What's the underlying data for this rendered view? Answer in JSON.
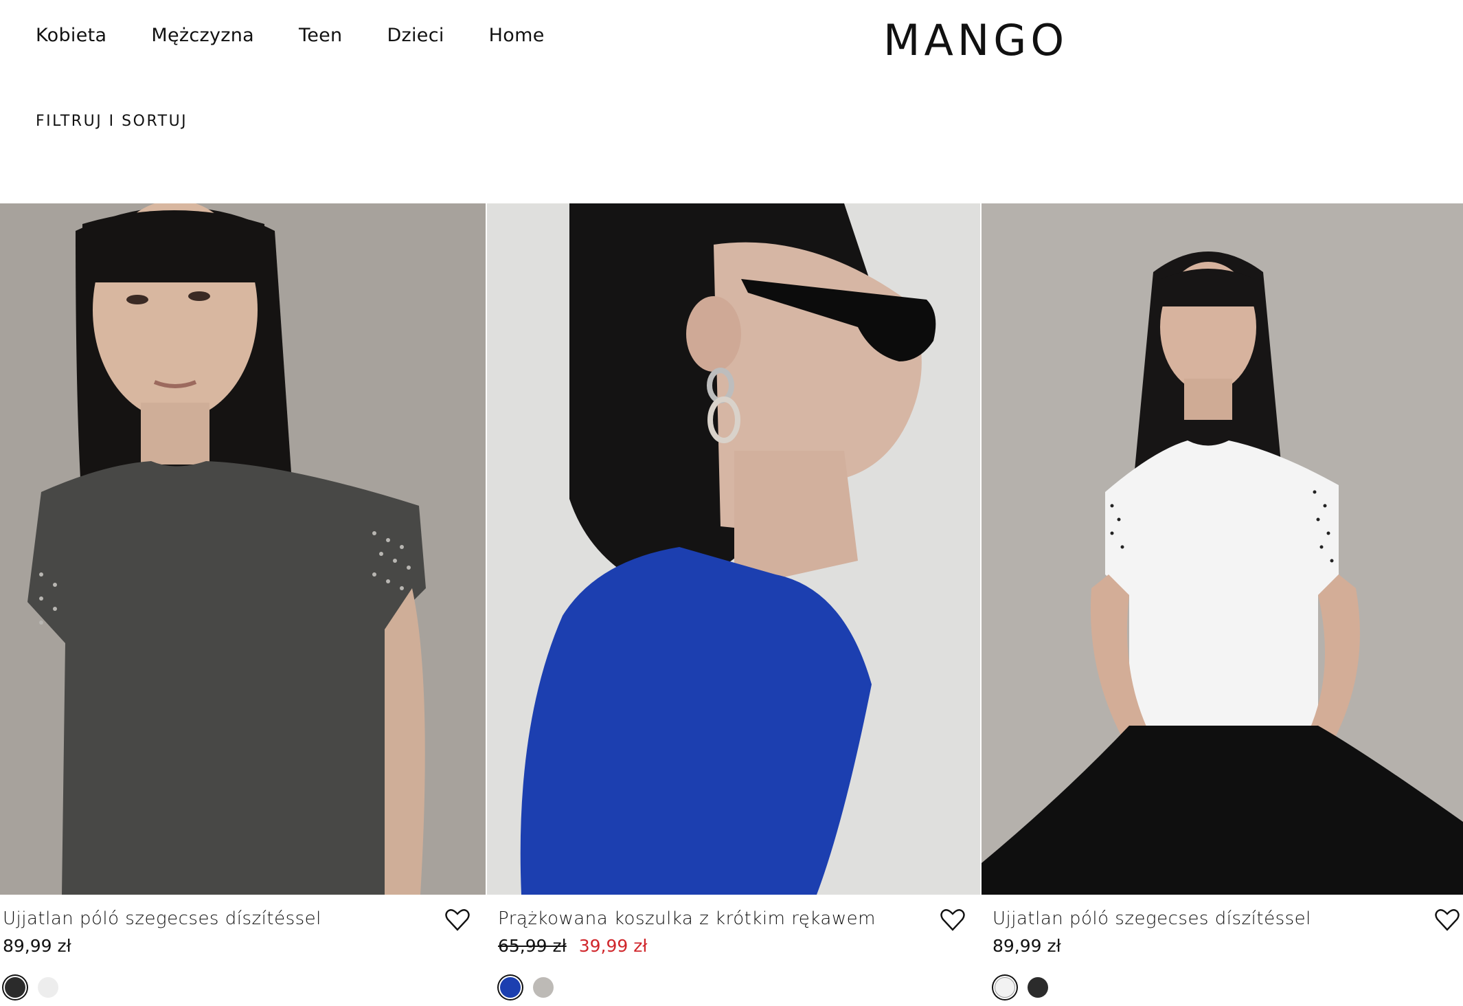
{
  "nav": {
    "items": [
      "Kobieta",
      "Mężczyzna",
      "Teen",
      "Dzieci",
      "Home"
    ]
  },
  "brand": {
    "logo": "MANGO"
  },
  "toolbar": {
    "filter_label": "FILTRUJ I SORTUJ"
  },
  "products": [
    {
      "name": "Ujjatlan póló szegecses díszítéssel",
      "price": "89,99 zł",
      "old_price": "",
      "colors": [
        "#2b2b2b",
        "#ededed"
      ],
      "selected_color": 0
    },
    {
      "name": "Prążkowana koszulka z krótkim rękawem",
      "price": "39,99 zł",
      "old_price": "65,99 zł",
      "colors": [
        "#1c3fb0",
        "#bdbab6"
      ],
      "selected_color": 0
    },
    {
      "name": "Ujjatlan póló szegecses díszítéssel",
      "price": "89,99 zł",
      "old_price": "",
      "colors": [
        "#f2f2f2",
        "#2b2b2b"
      ],
      "selected_color": 0
    }
  ],
  "colors": {
    "sale": "#d0262b",
    "text": "#111111",
    "background": "#ffffff"
  }
}
